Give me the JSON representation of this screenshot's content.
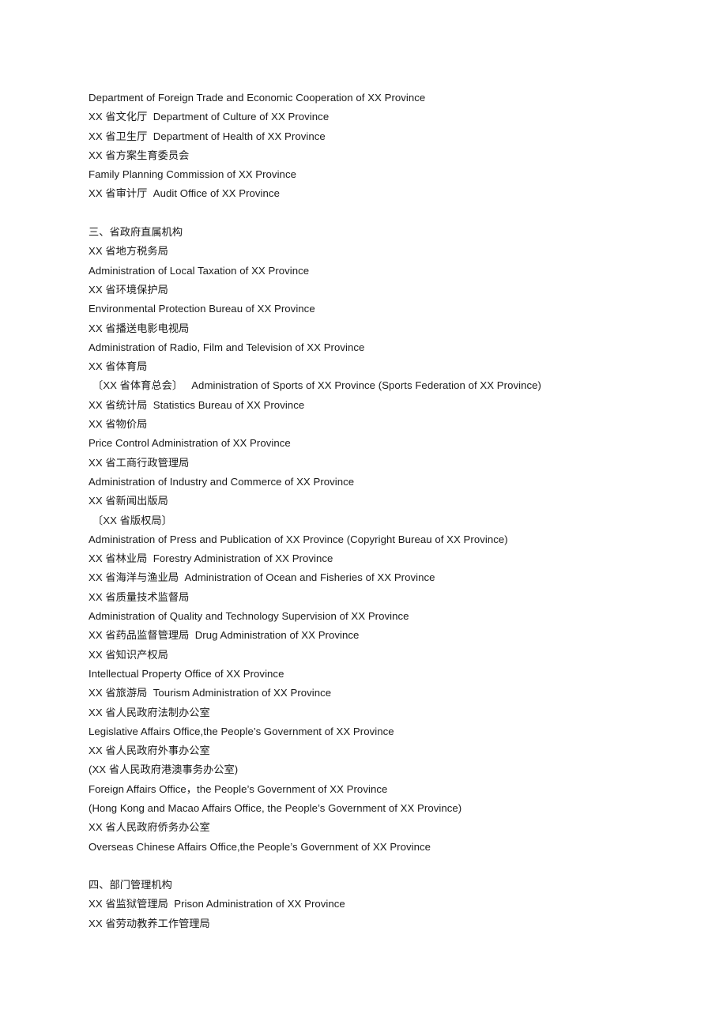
{
  "document": {
    "blocks": [
      {
        "type": "paragraph-group",
        "lines": [
          {
            "text": "Department of Foreign Trade and Economic Cooperation of XX Province",
            "indent": false
          },
          {
            "text": "XX 省文化厅  Department of Culture of XX Province",
            "indent": false
          },
          {
            "text": "XX 省卫生厅  Department of Health of XX Province",
            "indent": false
          },
          {
            "text": "XX 省方案生育委员会",
            "indent": false
          },
          {
            "text": "Family Planning Commission of XX Province",
            "indent": false
          },
          {
            "text": "XX 省审计厅  Audit Office of XX Province",
            "indent": false
          }
        ]
      },
      {
        "type": "spacer",
        "lines": [
          {
            "text": "",
            "indent": false
          }
        ]
      },
      {
        "type": "section",
        "lines": [
          {
            "text": "三、省政府直属机构",
            "indent": false
          },
          {
            "text": "XX 省地方税务局",
            "indent": false
          },
          {
            "text": "Administration of Local Taxation of XX Province",
            "indent": false
          },
          {
            "text": "XX 省环境保护局",
            "indent": false
          },
          {
            "text": "Environmental Protection Bureau of XX Province",
            "indent": false
          },
          {
            "text": "XX 省播送电影电视局",
            "indent": false
          },
          {
            "text": "Administration of Radio, Film and Television of XX Province",
            "indent": false
          },
          {
            "text": "XX 省体育局",
            "indent": false
          },
          {
            "text": "〔XX 省体育总会〕   Administration of Sports of XX Province (Sports Federation of XX Province)",
            "indent": true
          },
          {
            "text": "XX 省统计局  Statistics Bureau of XX Province",
            "indent": false
          },
          {
            "text": "XX 省物价局",
            "indent": false
          },
          {
            "text": "Price Control Administration of XX Province",
            "indent": false
          },
          {
            "text": "XX 省工商行政管理局",
            "indent": false
          },
          {
            "text": "Administration of Industry and Commerce of XX Province",
            "indent": false
          },
          {
            "text": "XX 省新闻出版局",
            "indent": false
          },
          {
            "text": "〔XX 省版权局〕",
            "indent": true
          },
          {
            "text": "Administration of Press and Publication of XX Province (Copyright Bureau of XX Province)",
            "indent": false
          },
          {
            "text": "XX 省林业局  Forestry Administration of XX Province",
            "indent": false
          },
          {
            "text": "XX 省海洋与渔业局  Administration of Ocean and Fisheries of XX Province",
            "indent": false
          },
          {
            "text": "XX 省质量技术监督局",
            "indent": false
          },
          {
            "text": "Administration of Quality and Technology Supervision of XX Province",
            "indent": false
          },
          {
            "text": "XX 省药品监督管理局  Drug Administration of XX Province",
            "indent": false
          },
          {
            "text": "XX 省知识产权局",
            "indent": false
          },
          {
            "text": "Intellectual Property Office of XX Province",
            "indent": false
          },
          {
            "text": "XX 省旅游局  Tourism Administration of XX Province",
            "indent": false
          },
          {
            "text": "XX 省人民政府法制办公室",
            "indent": false
          },
          {
            "text": "Legislative Affairs Office,the People’s Government of XX Province",
            "indent": false
          },
          {
            "text": "XX 省人民政府外事办公室",
            "indent": false
          },
          {
            "text": "(XX 省人民政府港澳事务办公室)",
            "indent": false
          },
          {
            "text": "Foreign Affairs Office，the People’s Government of XX Province",
            "indent": false
          },
          {
            "text": "(Hong Kong and Macao Affairs Office, the People’s Government of XX Province)",
            "indent": false
          },
          {
            "text": "XX 省人民政府侨务办公室",
            "indent": false
          },
          {
            "text": "Overseas Chinese Affairs Office,the People’s Government of XX Province",
            "indent": false
          }
        ]
      },
      {
        "type": "spacer",
        "lines": [
          {
            "text": "",
            "indent": false
          }
        ]
      },
      {
        "type": "section",
        "lines": [
          {
            "text": "四、部门管理机构",
            "indent": false
          },
          {
            "text": "XX 省监狱管理局  Prison Administration of XX Province",
            "indent": false
          },
          {
            "text": "XX 省劳动教养工作管理局",
            "indent": false
          }
        ]
      }
    ]
  }
}
